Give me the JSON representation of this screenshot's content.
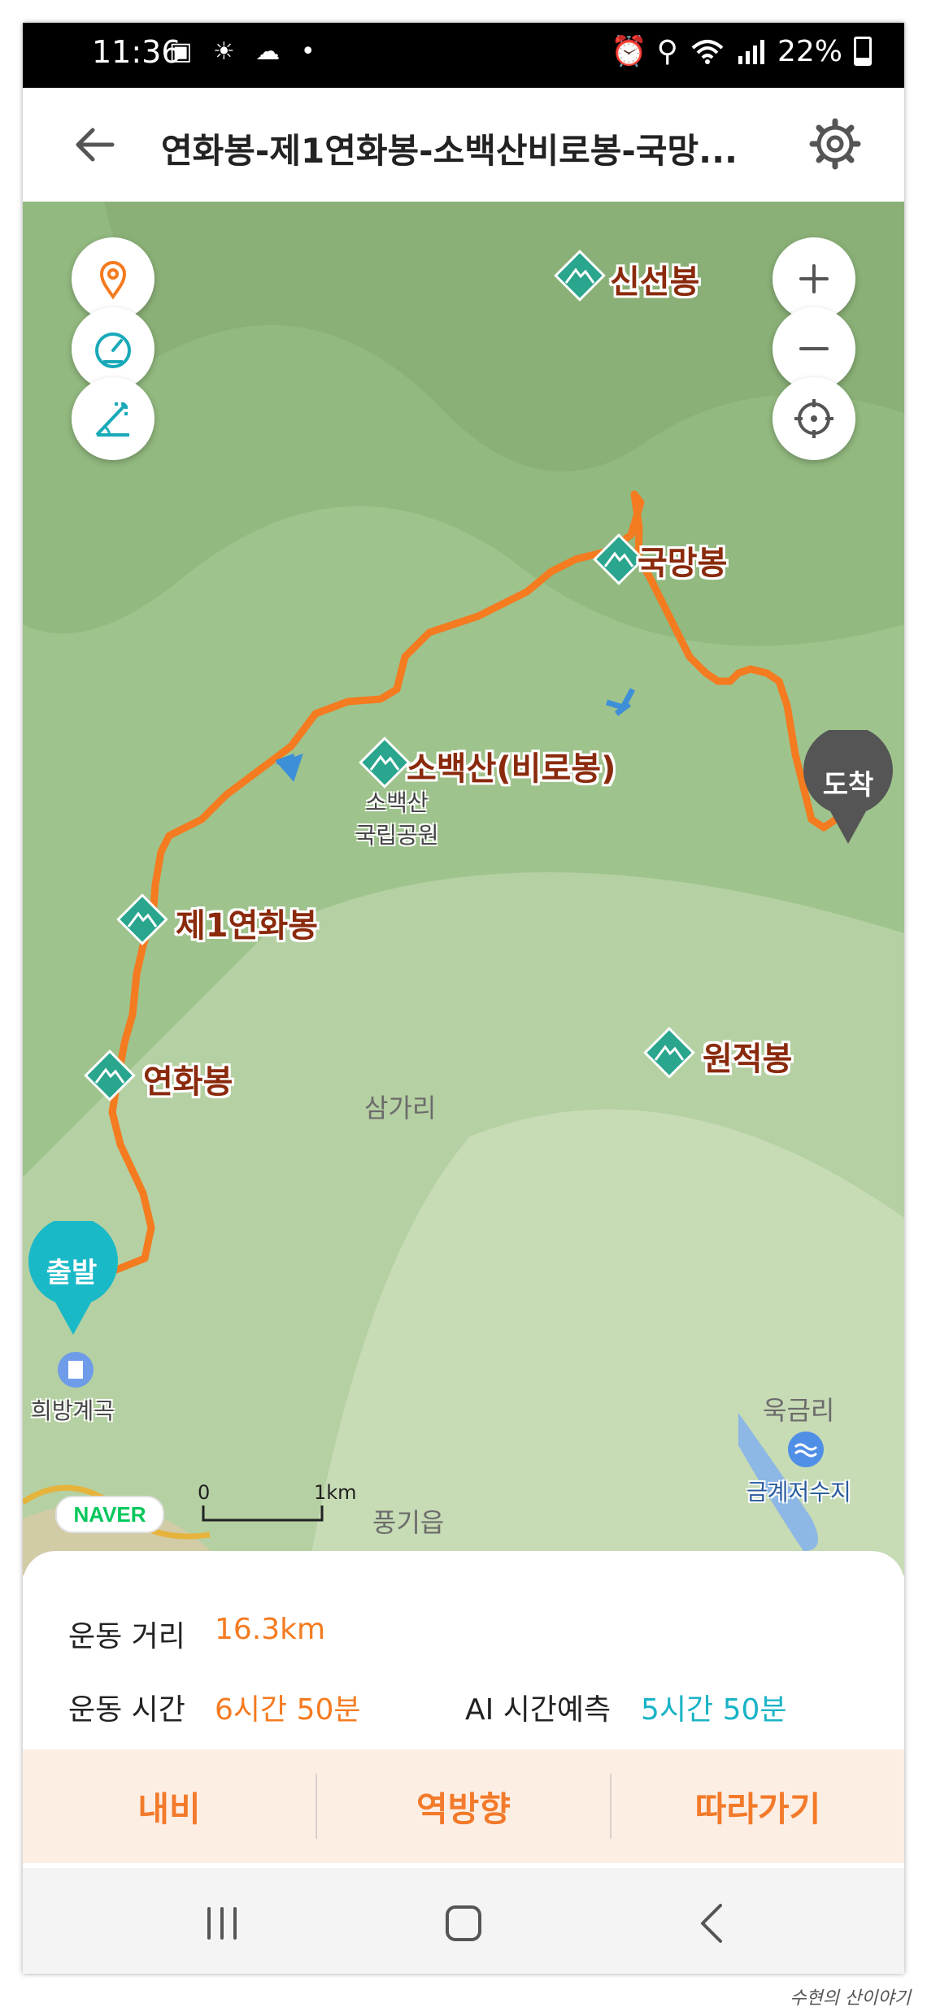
{
  "status_bar": {
    "time": "11:36",
    "left_icons": "▣ ☀ ☁ •",
    "right_icons": "⏰ ⚲",
    "battery": "22%"
  },
  "header": {
    "title": "연화봉-제1연화봉-소백산비로봉-국망..."
  },
  "map": {
    "places": {
      "sinseonbong": "신선봉",
      "gukmangbong": "국망봉",
      "sobaeksan": "소백산(비로봉)",
      "jeil": "제1연화봉",
      "yeonhwabong": "연화봉",
      "wonjeokbong": "원적봉"
    },
    "park_label": "소백산\n국립공원",
    "samgari": "삼가리",
    "ukgeumri": "욱금리",
    "geumgye": "금계저수지",
    "poonggi": "풍기읍",
    "heebang": "희방계곡",
    "start_label": "출발",
    "end_label": "도착",
    "naver": "NAVER",
    "scale_zero": "0",
    "scale_km": "1km",
    "route_color": "#f47b20"
  },
  "stats": {
    "distance_label": "운동 거리",
    "distance_value": "16.3km",
    "time_label": "운동 시간",
    "time_value": "6시간 50분",
    "ai_label": "AI 시간예측",
    "ai_value": "5시간 50분"
  },
  "actions": {
    "navi": "내비",
    "reverse": "역방향",
    "follow": "따라가기"
  },
  "watermark": "수현의 산이야기"
}
